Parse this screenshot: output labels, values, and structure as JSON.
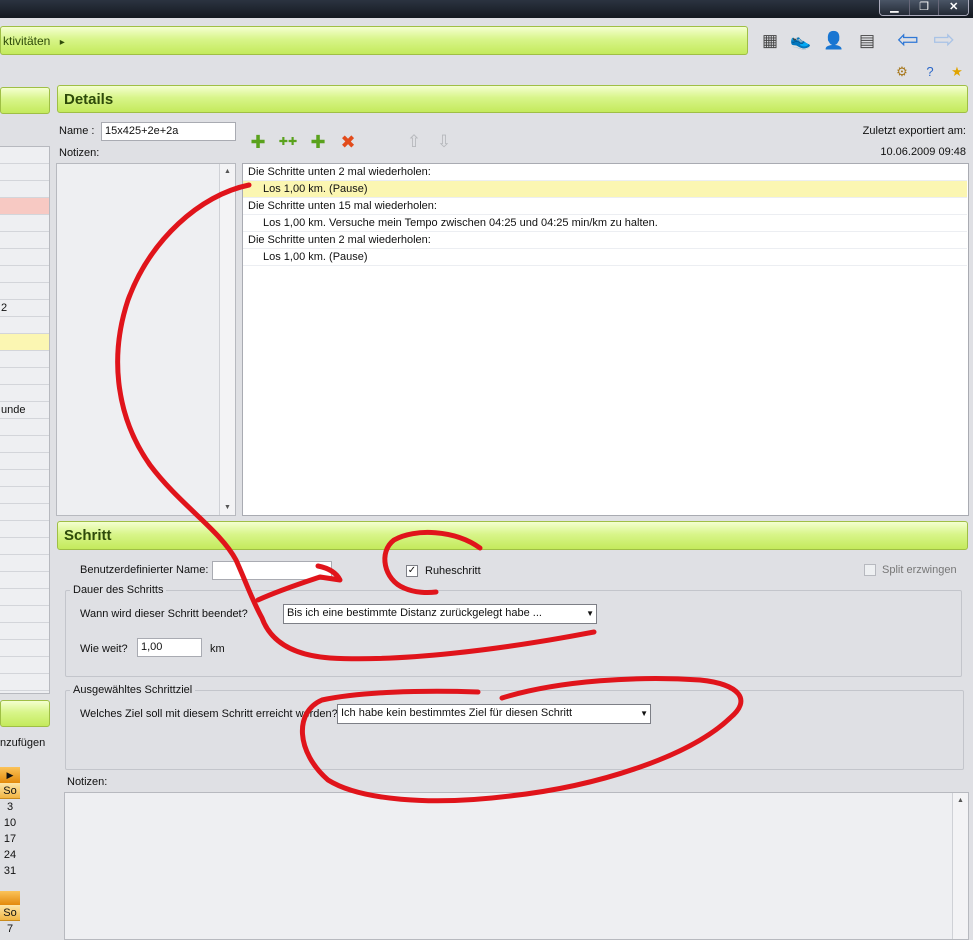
{
  "window": {
    "min_glyph": "▁",
    "max_glyph": "❐",
    "close_glyph": "✕"
  },
  "breadcrumb": {
    "text": "ktivitäten",
    "arrow": "▸"
  },
  "toolbar": {
    "icons": [
      "calendar-icon",
      "shoe-icon",
      "athlete-icon",
      "logbook-icon",
      "back-arrow-icon",
      "forward-arrow-icon"
    ],
    "small_icons": [
      "settings-gear-icon",
      "help-icon",
      "favorites-star-icon"
    ]
  },
  "left": {
    "rows": [
      "",
      "",
      "",
      "",
      "",
      "",
      "",
      "",
      "",
      "2",
      "",
      "",
      "",
      "",
      "",
      "unde",
      "",
      "",
      "",
      "",
      "",
      "",
      "",
      "",
      "",
      "",
      "",
      "",
      "",
      "",
      "",
      ""
    ],
    "add_text": "nzufügen",
    "cal1": {
      "nav": "▶",
      "header": "So",
      "days": [
        "3",
        "10",
        "17",
        "24",
        "31"
      ]
    },
    "cal2": {
      "header": "So",
      "days": [
        "7"
      ]
    }
  },
  "details": {
    "title": "Details",
    "name_label": "Name :",
    "name_value": "15x425+2e+2a",
    "notes_label": "Notizen:",
    "exported_label": "Zuletzt exportiert am:",
    "exported_value": "10.06.2009 09:48",
    "action_icons": [
      "add-step-icon",
      "add-repeat-icon",
      "add-custom-icon",
      "delete-icon",
      "move-up-icon",
      "move-down-icon"
    ],
    "steps": [
      {
        "text": "Die Schritte unten 2 mal wiederholen:",
        "indent": false,
        "selected": false
      },
      {
        "text": "Los 1,00 km.   (Pause)",
        "indent": true,
        "selected": true
      },
      {
        "text": "Die Schritte unten 15 mal wiederholen:",
        "indent": false,
        "selected": false
      },
      {
        "text": "Los 1,00 km.  Versuche mein Tempo zwischen 04:25 und 04:25 min/km zu halten.",
        "indent": true,
        "selected": false
      },
      {
        "text": "Die Schritte unten 2 mal wiederholen:",
        "indent": false,
        "selected": false
      },
      {
        "text": "Los 1,00 km.   (Pause)",
        "indent": true,
        "selected": false
      }
    ]
  },
  "schritt": {
    "title": "Schritt",
    "custom_name_label": "Benutzerdefinierter Name:",
    "custom_name_value": "",
    "rest_label": "Ruheschritt",
    "rest_checked": "✓",
    "split_label": "Split erzwingen",
    "duration_group": "Dauer des Schritts",
    "end_label": "Wann wird dieser Schritt beendet?",
    "end_value": "Bis ich eine bestimmte Distanz zurückgelegt habe ...",
    "distance_label": "Wie weit?",
    "distance_value": "1,00",
    "distance_unit": "km",
    "target_group": "Ausgewähltes Schrittziel",
    "target_label": "Welches Ziel soll mit diesem Schritt erreicht werden?",
    "target_value": "Ich habe kein bestimmtes Ziel für diesen Schritt",
    "notes_label": "Notizen:"
  },
  "colors": {
    "accent_green": "#c4ea5c",
    "selection": "#fbf6b2",
    "annotation_red": "#e0141b"
  }
}
